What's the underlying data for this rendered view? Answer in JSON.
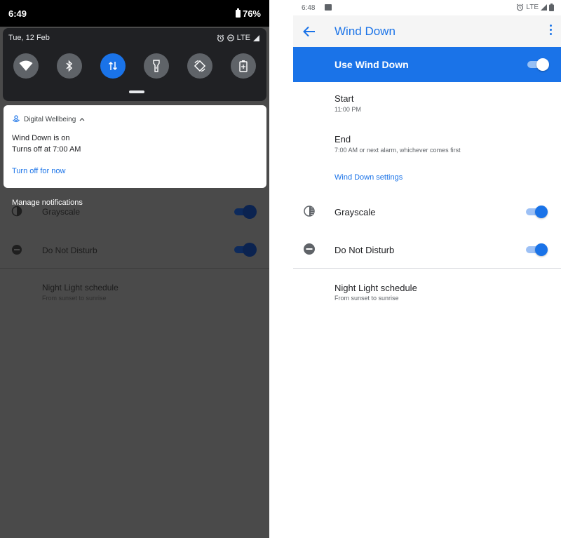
{
  "colors": {
    "accent": "#1a73e8",
    "shade_bg": "#202124",
    "dimmed_bg": "#4a4a4a"
  },
  "left": {
    "status_bar": {
      "time": "6:49",
      "battery": "76%"
    },
    "quick_settings": {
      "date": "Tue, 12 Feb",
      "network": "LTE",
      "tiles": [
        {
          "icon": "wifi-icon",
          "active": false
        },
        {
          "icon": "bluetooth-icon",
          "active": false
        },
        {
          "icon": "mobile-data-icon",
          "active": true
        },
        {
          "icon": "flashlight-icon",
          "active": false
        },
        {
          "icon": "auto-rotate-icon",
          "active": false
        },
        {
          "icon": "battery-saver-icon",
          "active": false
        }
      ]
    },
    "notification": {
      "app_name": "Digital Wellbeing",
      "title": "Wind Down is on",
      "body": "Turns off at 7:00 AM",
      "action": "Turn off for now"
    },
    "manage_notifications": "Manage notifications",
    "background_settings": {
      "grayscale": "Grayscale",
      "dnd": "Do Not Disturb",
      "night_light": "Night Light schedule",
      "night_light_sub": "From sunset to sunrise"
    }
  },
  "right": {
    "status_bar": {
      "time": "6:48",
      "network": "LTE"
    },
    "app_bar": {
      "title": "Wind Down"
    },
    "master_switch": {
      "label": "Use Wind Down",
      "on": true
    },
    "start": {
      "label": "Start",
      "value": "11:00 PM"
    },
    "end": {
      "label": "End",
      "value": "7:00 AM or next alarm, whichever comes first"
    },
    "settings_link": "Wind Down settings",
    "grayscale": {
      "label": "Grayscale",
      "on": true
    },
    "dnd": {
      "label": "Do Not Disturb",
      "on": true
    },
    "night_light": {
      "label": "Night Light schedule",
      "sub": "From sunset to sunrise"
    }
  }
}
